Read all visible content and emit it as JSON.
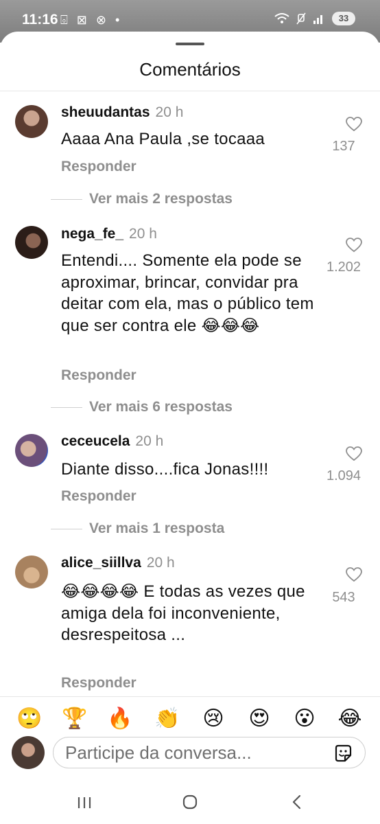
{
  "status_bar": {
    "time": "11:16",
    "left_icons": "⌻ ⊠ ⊗ •",
    "battery": "33"
  },
  "sheet": {
    "title": "Comentários"
  },
  "comments": [
    {
      "username": "sheuudantas",
      "time": "20 h",
      "text": "Aaaa Ana Paula ,se tocaaa",
      "likes": "137",
      "reply_label": "Responder",
      "more_replies": "Ver mais 2 respostas",
      "avatar_color": "#5a3b30"
    },
    {
      "username": "nega_fe_",
      "time": "20 h",
      "text": "Entendi.... Somente ela pode se aproximar, brincar, convidar pra deitar com ela, mas o público tem que ser contra ele 😂😂😂",
      "likes": "1.202",
      "reply_label": "Responder",
      "more_replies": "Ver mais 6 respostas",
      "avatar_color": "#2b1d18"
    },
    {
      "username": "ceceucela",
      "time": "20 h",
      "text": "Diante disso....fica Jonas!!!!",
      "likes": "1.094",
      "reply_label": "Responder",
      "more_replies": "Ver mais 1 resposta",
      "avatar_color": "#6b4f7a"
    },
    {
      "username": "alice_siillva",
      "time": "20 h",
      "text": "😂😂😂😂 E todas as vezes que amiga dela foi inconveniente, desrespeitosa ...",
      "likes": "543",
      "reply_label": "Responder",
      "avatar_color": "#a8825f"
    }
  ],
  "emoji_bar": [
    "🙄",
    "🏆",
    "🔥",
    "👏",
    "😢",
    "😍",
    "😮",
    "😂"
  ],
  "composer": {
    "placeholder": "Participe da conversa...",
    "avatar_color": "#4a3a33"
  },
  "colors": {
    "secondary_text": "#8e8e8e",
    "primary_text": "#111111",
    "divider": "#e6e6e6"
  }
}
